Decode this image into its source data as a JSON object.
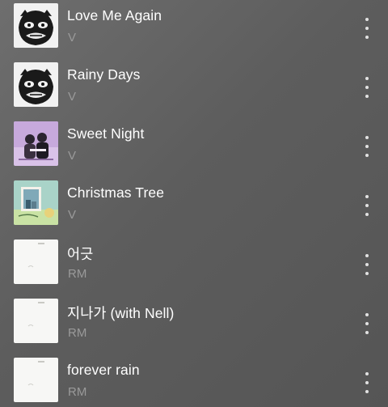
{
  "tracks": [
    {
      "title": "Love Me Again",
      "artist": "V",
      "art": "v-layover-bw"
    },
    {
      "title": "Rainy Days",
      "artist": "V",
      "art": "v-layover-bw"
    },
    {
      "title": "Sweet Night",
      "artist": "V",
      "art": "itaewon-class-ost"
    },
    {
      "title": "Christmas Tree",
      "artist": "V",
      "art": "our-beloved-summer-ost"
    },
    {
      "title": "어긋",
      "artist": "RM",
      "art": "indigo-white"
    },
    {
      "title": "지나가 (with Nell)",
      "artist": "RM",
      "art": "indigo-white"
    },
    {
      "title": "forever rain",
      "artist": "RM",
      "art": "indigo-white"
    }
  ],
  "icons": {
    "more": "more-vertical-icon"
  }
}
